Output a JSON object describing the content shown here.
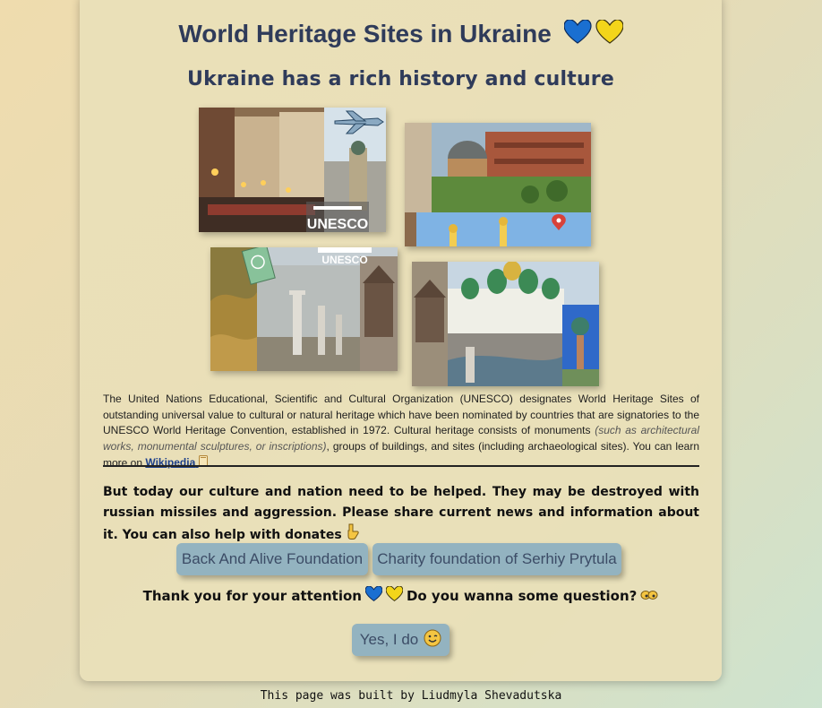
{
  "header": {
    "title": "World Heritage Sites in Ukraine",
    "subtitle": "Ukraine has a rich history and culture"
  },
  "colors": {
    "heart_blue": "#1a6fd1",
    "heart_yellow": "#f3d51a",
    "button_bg": "#93b3c0",
    "button_text": "#3c4c66",
    "title_text": "#2f3b5a"
  },
  "gallery": {
    "images": [
      {
        "name": "lviv-old-town-collage",
        "text": "UNESCO"
      },
      {
        "name": "chernivtsi-residence-collage"
      },
      {
        "name": "chersonesus-collage",
        "text": "UNESCO"
      },
      {
        "name": "kyiv-saint-sophia-collage"
      }
    ]
  },
  "description": {
    "part1": "The United Nations Educational, Scientific and Cultural Organization (UNESCO) designates World Heritage Sites of outstanding universal value to cultural or natural heritage which have been nominated by countries that are signatories to the UNESCO World Heritage Convention, established in 1972. Cultural heritage consists of monuments ",
    "italic": "(such as architectural works, monumental sculptures, or inscriptions)",
    "part2": ", groups of buildings, and sites (including archaeological sites). You can learn more on ",
    "link_label": "Wikipedia",
    "link_icon": "book-icon"
  },
  "help": {
    "text": "But today our culture and nation need to be helped. They may be destroyed with russian missiles and aggression. Please share current news and information about it. You can also help with donates",
    "icon": "pointing-down-hand-icon"
  },
  "donate_buttons": [
    {
      "label": "Back And Alive Foundation"
    },
    {
      "label": "Charity foundation of Serhiy Prytula"
    }
  ],
  "thanks": {
    "text1": "Thank you for your attention",
    "text2": "Do you wanna some question?",
    "icon": "eyes-icon"
  },
  "question_button": {
    "label": "Yes, I do",
    "icon": "smiling-face-icon"
  },
  "footer": {
    "text": "This page was built by Liudmyla Shevadutska"
  }
}
